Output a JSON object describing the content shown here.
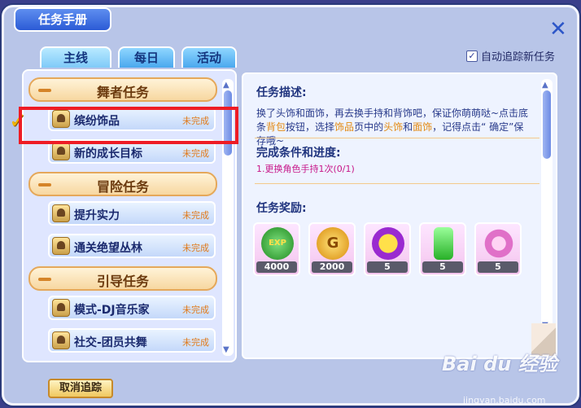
{
  "window": {
    "title": "任务手册"
  },
  "tabs": [
    {
      "label": "主线",
      "active": true
    },
    {
      "label": "每日",
      "active": false
    },
    {
      "label": "活动",
      "active": false
    }
  ],
  "auto_track": {
    "label": "自动追踪新任务",
    "checked": true
  },
  "categories": [
    {
      "label": "舞者任务"
    },
    {
      "label": "冒险任务"
    },
    {
      "label": "引导任务"
    }
  ],
  "tasks": [
    {
      "name": "缤纷饰品",
      "status": "未完成",
      "icon": "costume-icon",
      "selected": true
    },
    {
      "name": "新的成长目标",
      "status": "未完成",
      "icon": "level-icon"
    },
    {
      "name": "提升实力",
      "status": "未完成",
      "icon": "adventure-icon"
    },
    {
      "name": "通关绝望丛林",
      "status": "未完成",
      "icon": "adventure-icon"
    },
    {
      "name": "模式-DJ音乐家",
      "status": "未完成",
      "icon": "guide-icon"
    },
    {
      "name": "社交-团员共舞",
      "status": "未完成",
      "icon": "guide-icon"
    }
  ],
  "detail": {
    "desc_title": "任务描述:",
    "desc_part1": "换了头饰和面饰，再去换手持和背饰吧，保证你萌萌哒~点击底条",
    "desc_hl1": "背包",
    "desc_part2": "按钮，选择",
    "desc_hl2": "饰品",
    "desc_part3": "页中的",
    "desc_hl3": "头饰",
    "desc_part4": "和",
    "desc_hl4": "面饰",
    "desc_part5": "，记得点击“ 确定”保存哦~",
    "cond_title": "完成条件和进度:",
    "cond_text": "1.更换角色手持1次(0/1)",
    "reward_title": "任务奖励:",
    "rewards": [
      {
        "icon": "exp-icon",
        "label": "EXP",
        "count": "4000",
        "color": "#2aa02a"
      },
      {
        "icon": "gold-coin-icon",
        "label": "G",
        "count": "2000",
        "color": "#e8a014"
      },
      {
        "icon": "emoji-icon",
        "label": "",
        "count": "5",
        "color": "#9a2ad0"
      },
      {
        "icon": "potion-icon",
        "label": "",
        "count": "5",
        "color": "#3ac83a"
      },
      {
        "icon": "flower-icon",
        "label": "",
        "count": "5",
        "color": "#e070c8"
      }
    ]
  },
  "buttons": {
    "cancel_track": "取消追踪"
  },
  "watermark": {
    "brand": "Bai du 经验",
    "url": "jingyan.baidu.com"
  }
}
